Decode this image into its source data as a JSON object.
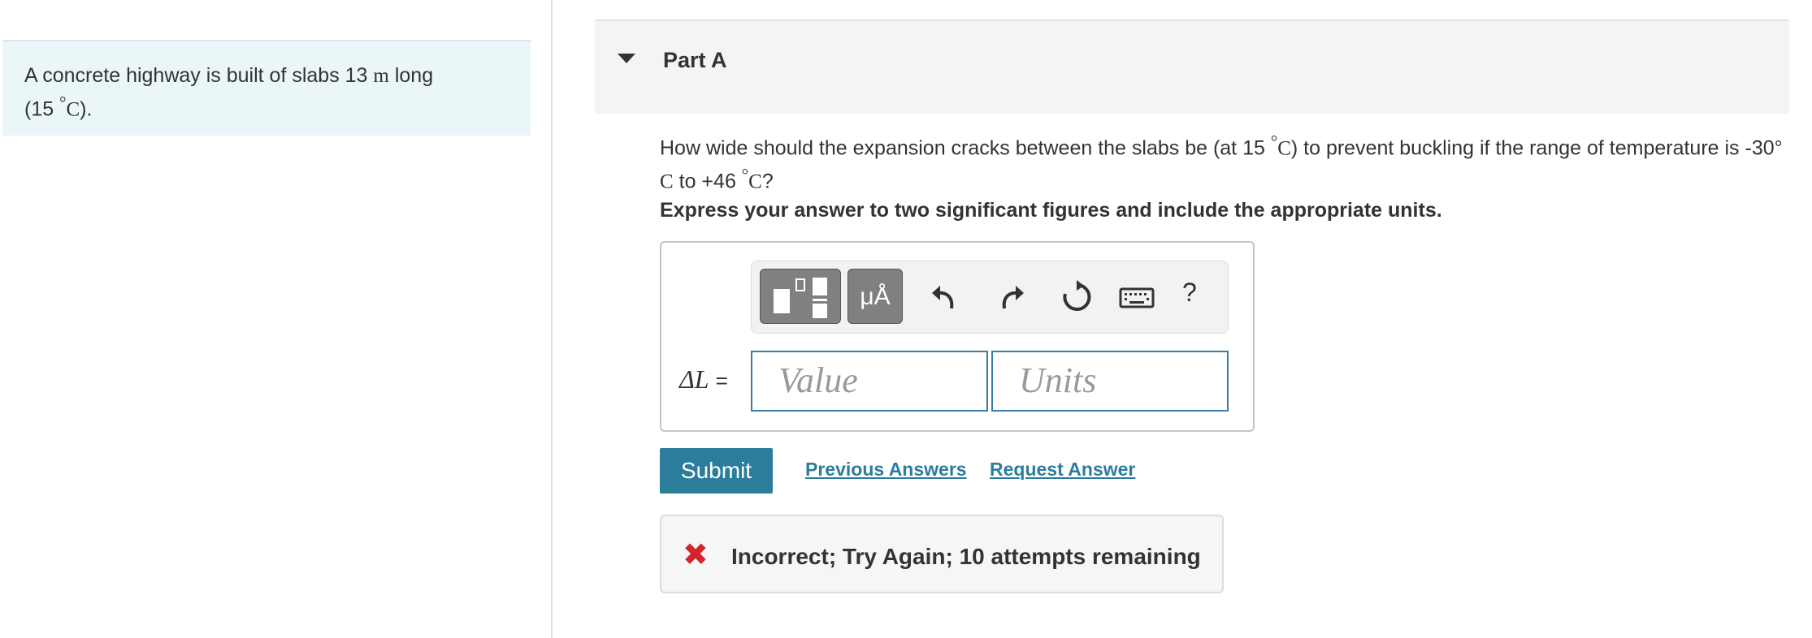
{
  "intro": {
    "text_a": "A concrete highway is built of slabs 13",
    "unit_m": "m",
    "text_b": "long",
    "text_c": "(15",
    "deg": "°",
    "unit_C": "C",
    "text_d": ")."
  },
  "part": {
    "title": "Part A"
  },
  "question": {
    "q1": "How wide should the expansion cracks between the slabs be (at 15",
    "q_deg": "°",
    "q_C": "C",
    "q2": ") to prevent buckling if the range of temperature is -30°",
    "q3": "C",
    "q4": "to +46",
    "q5": "°",
    "q6": "C",
    "q7": "?"
  },
  "instruction": "Express your answer to two significant figures and include the appropriate units.",
  "toolbar": {
    "templates_icon": "fraction-template-icon",
    "units_label": "μÅ",
    "undo_icon": "undo-icon",
    "redo_icon": "redo-icon",
    "reset_icon": "reset-icon",
    "keyboard_icon": "keyboard-icon",
    "help_label": "?"
  },
  "answer": {
    "variable": "ΔL",
    "equals": "=",
    "value_placeholder": "Value",
    "units_placeholder": "Units"
  },
  "actions": {
    "submit": "Submit",
    "previous_answers": "Previous Answers",
    "request_answer": "Request Answer"
  },
  "feedback": {
    "icon": "x-mark-icon",
    "text": "Incorrect; Try Again; 10 attempts remaining"
  },
  "colors": {
    "accent": "#2c7d9c",
    "error": "#d0252d",
    "intro_bg": "#eaf6f8"
  }
}
